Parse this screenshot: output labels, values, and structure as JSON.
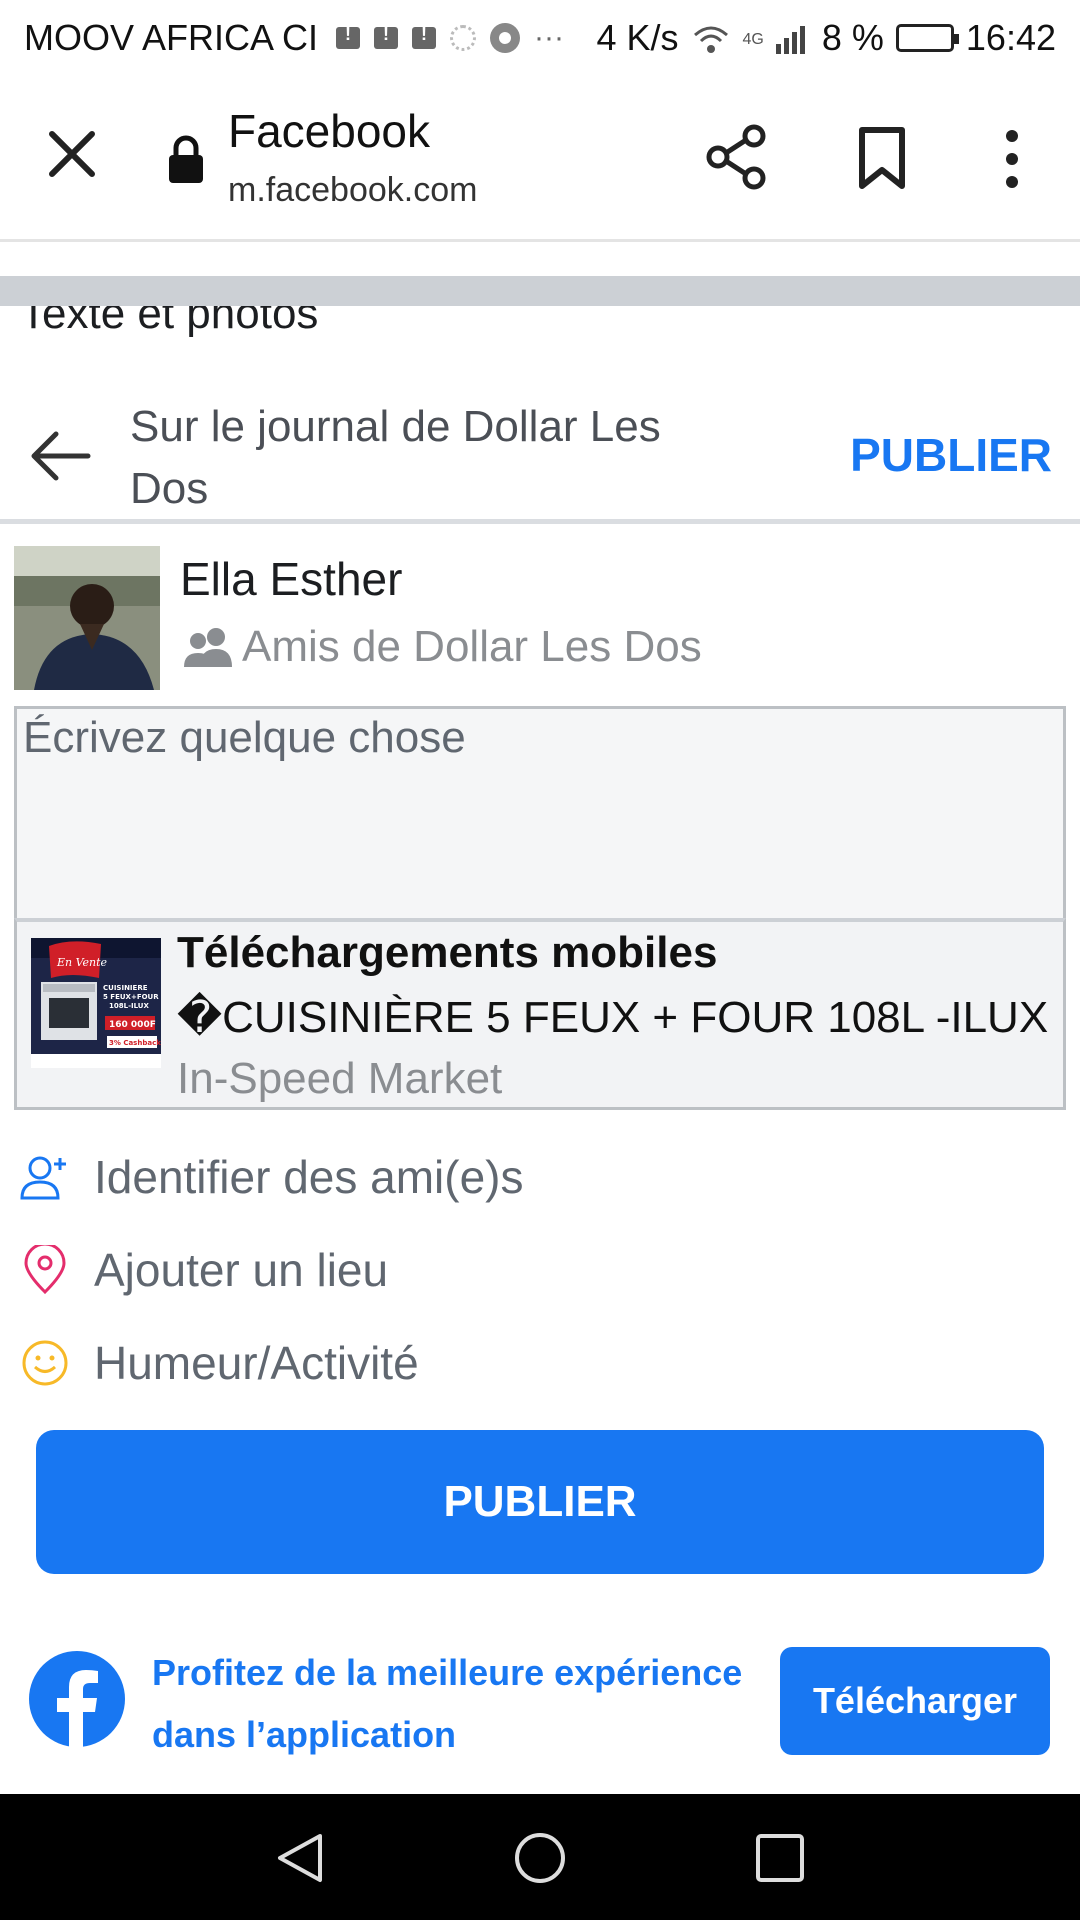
{
  "status_bar": {
    "carrier": "MOOV AFRICA CI",
    "speed": "4 K/s",
    "network": "4G",
    "battery": "8 %",
    "time": "16:42"
  },
  "browser": {
    "title": "Facebook",
    "url": "m.facebook.com"
  },
  "page": {
    "cutoff_heading": "Texte et photos",
    "compose_heading": "Sur le journal de Dollar Les Dos",
    "publish_link": "PUBLIER"
  },
  "user": {
    "name": "Ella Esther",
    "audience": "Amis de Dollar Les Dos"
  },
  "composer": {
    "placeholder": "Écrivez quelque chose"
  },
  "link_preview": {
    "title": "Téléchargements mobiles",
    "description": "�CUISINIÈRE 5 FEUX + FOUR 108L -ILUX",
    "domain": "In-Speed Market",
    "thumb_text": [
      "En Vente",
      "CUISINIERE",
      "5 FEUX+FOUR",
      "108L-ILUX",
      "160 000F",
      "3% Cashback"
    ]
  },
  "options": [
    {
      "label": "Identifier des ami(e)s",
      "icon": "add-person-icon",
      "color": "#1877f2"
    },
    {
      "label": "Ajouter un lieu",
      "icon": "location-pin-icon",
      "color": "#e42d6c"
    },
    {
      "label": "Humeur/Activité",
      "icon": "smiley-icon",
      "color": "#f7b928"
    }
  ],
  "publish_button": "PUBLIER",
  "app_banner": {
    "text": "Profitez de la meilleure expérience dans l’application",
    "button": "Télécharger"
  },
  "colors": {
    "accent": "#1877f2"
  }
}
